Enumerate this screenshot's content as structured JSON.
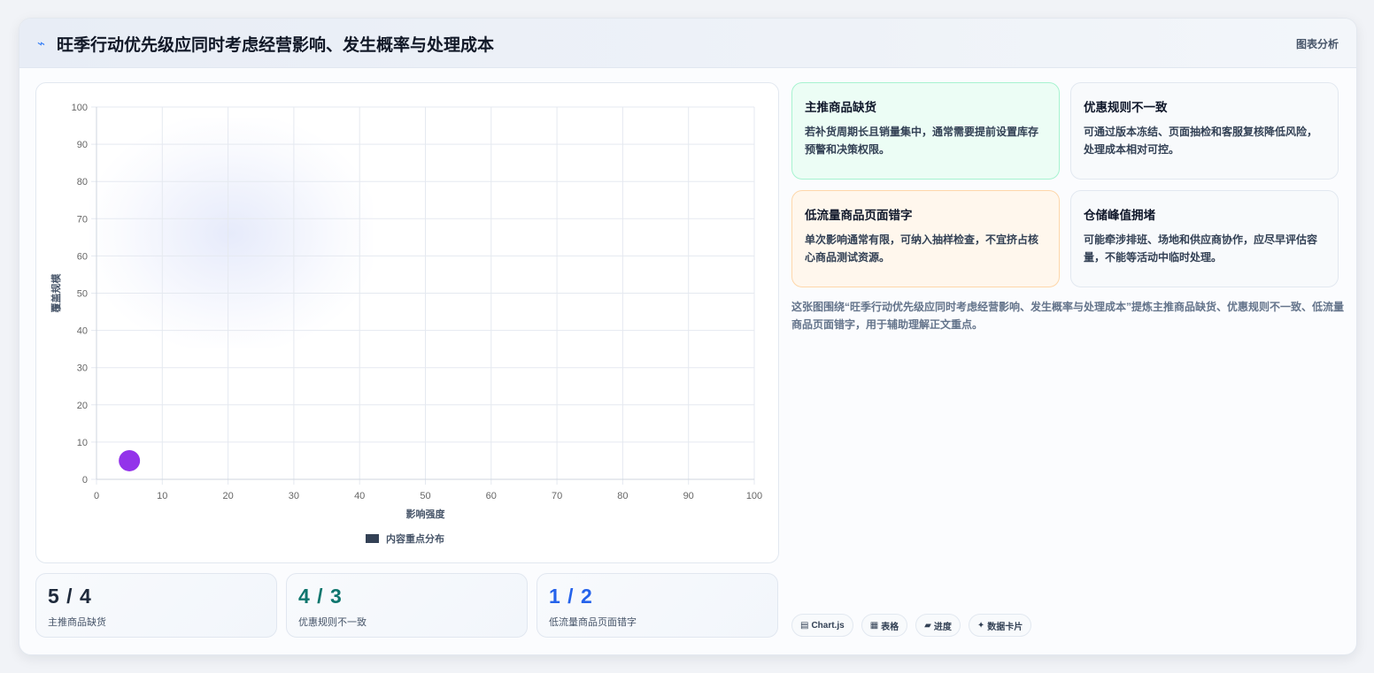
{
  "header": {
    "icon": "lightning-icon",
    "title": "旺季行动优先级应同时考虑经营影响、发生概率与处理成本",
    "right_label": "图表分析"
  },
  "chart_data": {
    "type": "scatter",
    "xlabel": "影响强度",
    "ylabel": "覆盖规模",
    "xlim": [
      0,
      100
    ],
    "ylim": [
      0,
      100
    ],
    "xticks": [
      0,
      10,
      20,
      30,
      40,
      50,
      60,
      70,
      80,
      90,
      100
    ],
    "yticks": [
      0,
      10,
      20,
      30,
      40,
      50,
      60,
      70,
      80,
      90,
      100
    ],
    "grid": true,
    "legend_position": "bottom",
    "series": [
      {
        "name": "内容重点分布",
        "color": "#9333ea",
        "legend_color": "#334155",
        "points": [
          {
            "x": 5,
            "y": 5
          }
        ]
      }
    ]
  },
  "stats": [
    {
      "value": "5 / 4",
      "label": "主推商品缺货",
      "color": "#1e293b"
    },
    {
      "value": "4 / 3",
      "label": "优惠规则不一致",
      "color": "#0f766e"
    },
    {
      "value": "1 / 2",
      "label": "低流量商品页面错字",
      "color": "#2563eb"
    }
  ],
  "notes": [
    {
      "title": "主推商品缺货",
      "body": "若补货周期长且销量集中，通常需要提前设置库存预警和决策权限。",
      "bg": "#ecfdf5",
      "border": "#a7f3d0"
    },
    {
      "title": "优惠规则不一致",
      "body": "可通过版本冻结、页面抽检和客服复核降低风险，处理成本相对可控。",
      "bg": "#f8fafc",
      "border": "#e2e8f0"
    },
    {
      "title": "低流量商品页面错字",
      "body": "单次影响通常有限，可纳入抽样检查，不宜挤占核心商品测试资源。",
      "bg": "#fff7ed",
      "border": "#fed7aa"
    },
    {
      "title": "仓储峰值拥堵",
      "body": "可能牵涉排班、场地和供应商协作，应尽早评估容量，不能等活动中临时处理。",
      "bg": "#f8fafc",
      "border": "#e2e8f0"
    }
  ],
  "description": "这张图围绕“旺季行动优先级应同时考虑经营影响、发生概率与处理成本”提炼主推商品缺货、优惠规则不一致、低流量商品页面错字，用于辅助理解正文重点。",
  "tags": [
    {
      "icon": "chart-icon",
      "glyph": "▤",
      "label": "Chart.js"
    },
    {
      "icon": "table-icon",
      "glyph": "▦",
      "label": "表格"
    },
    {
      "icon": "progress-icon",
      "glyph": "▰",
      "label": "进度"
    },
    {
      "icon": "data-card-icon",
      "glyph": "✦",
      "label": "数据卡片"
    }
  ]
}
